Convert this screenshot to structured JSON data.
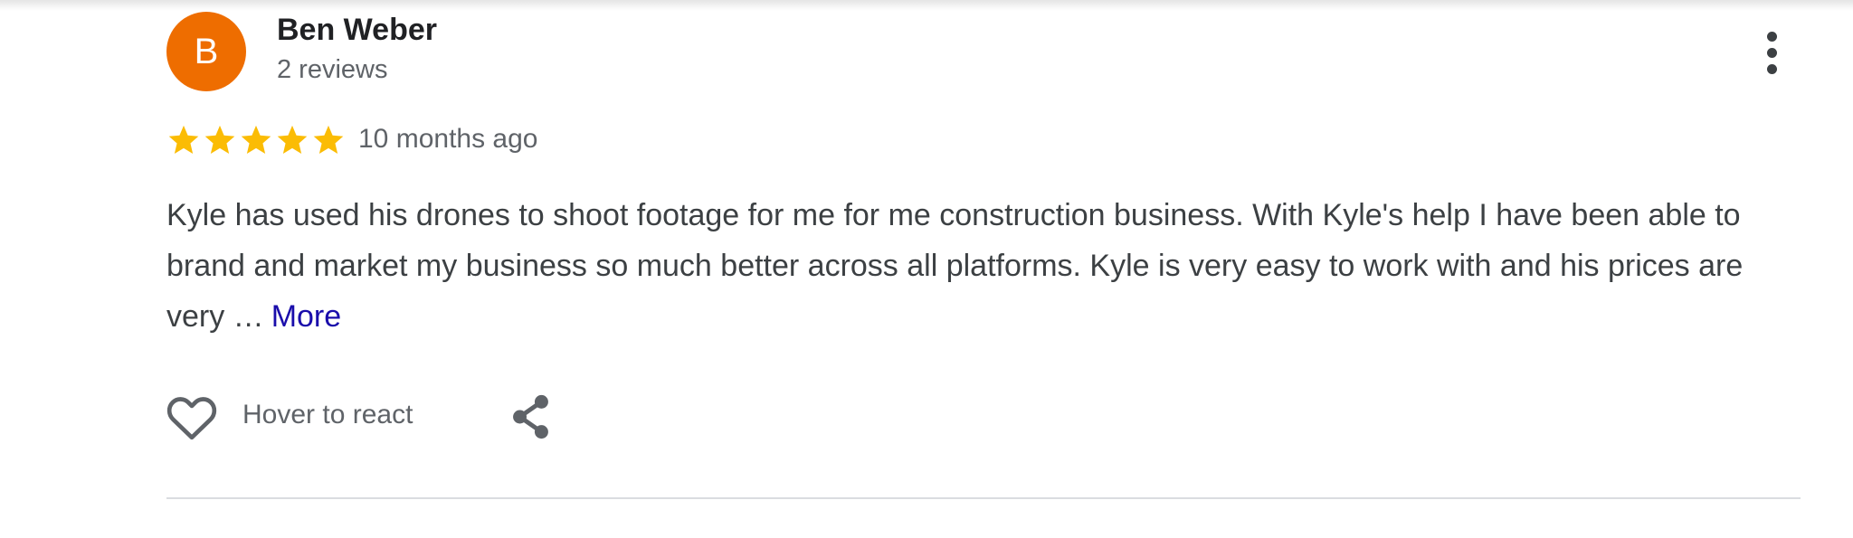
{
  "review": {
    "reviewer": {
      "avatar_letter": "B",
      "avatar_color": "#ee6d00",
      "name": "Ben Weber",
      "review_count": "2 reviews"
    },
    "rating": {
      "value": 5,
      "max": 5,
      "star_color": "#fbbc04"
    },
    "date": "10 months ago",
    "text": "Kyle has used his drones to shoot footage for me for me construction business. With Kyle's help I have been able to brand and market my business so much better across all platforms. Kyle is very easy to work with and his prices are very …",
    "more_label": "More",
    "more_link_color": "#1a0dab",
    "actions": {
      "react_label": "Hover to react",
      "react_icon": "heart-outline-icon",
      "share_icon": "share-icon",
      "menu_icon": "more-vert-icon"
    }
  }
}
